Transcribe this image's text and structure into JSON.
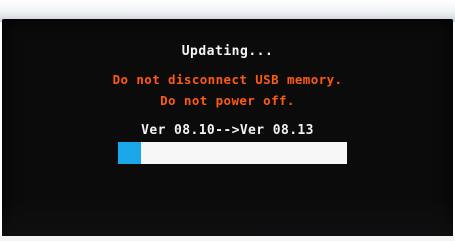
{
  "update_screen": {
    "status_text": "Updating...",
    "warning_line_1": "Do not disconnect USB memory.",
    "warning_line_2": "Do not power off.",
    "version_text": "Ver 08.10-->Ver 08.13",
    "progress_fraction": 0.1
  },
  "colors": {
    "screen_background": "#0b0b0c",
    "status_text": "#f4f4f4",
    "warning_text": "#ff5a12",
    "progress_fill": "#1aa6e8",
    "progress_track": "#f7f7f7"
  }
}
